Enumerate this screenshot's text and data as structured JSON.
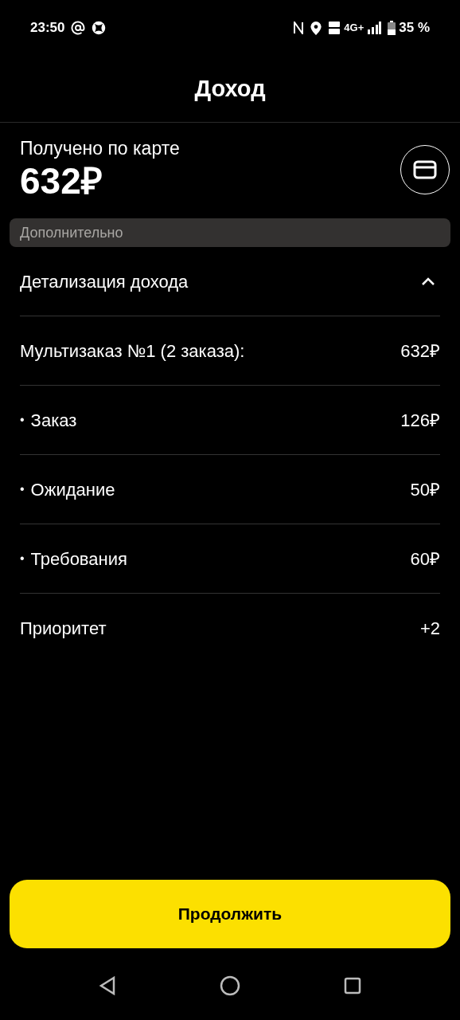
{
  "status_bar": {
    "time": "23:50",
    "network": "4G+",
    "battery": "35 %"
  },
  "header": {
    "title": "Доход"
  },
  "summary": {
    "label": "Получено по карте",
    "amount": "632₽"
  },
  "section": {
    "title": "Дополнительно"
  },
  "details": {
    "title": "Детализация дохода",
    "expanded": true,
    "rows": [
      {
        "kind": "plain",
        "label": "Мультизаказ №1 (2 заказа):",
        "value": "632₽"
      },
      {
        "kind": "bullet",
        "bullet": "•",
        "label": "Заказ",
        "value": "126₽"
      },
      {
        "kind": "bullet",
        "bullet": "•",
        "label": "Ожидание",
        "value": "50₽"
      },
      {
        "kind": "bullet",
        "bullet": "•",
        "label": "Требования",
        "value": "60₽"
      },
      {
        "kind": "plain",
        "label": "Приоритет",
        "value": "+2"
      }
    ]
  },
  "button": {
    "label": "Продолжить"
  }
}
